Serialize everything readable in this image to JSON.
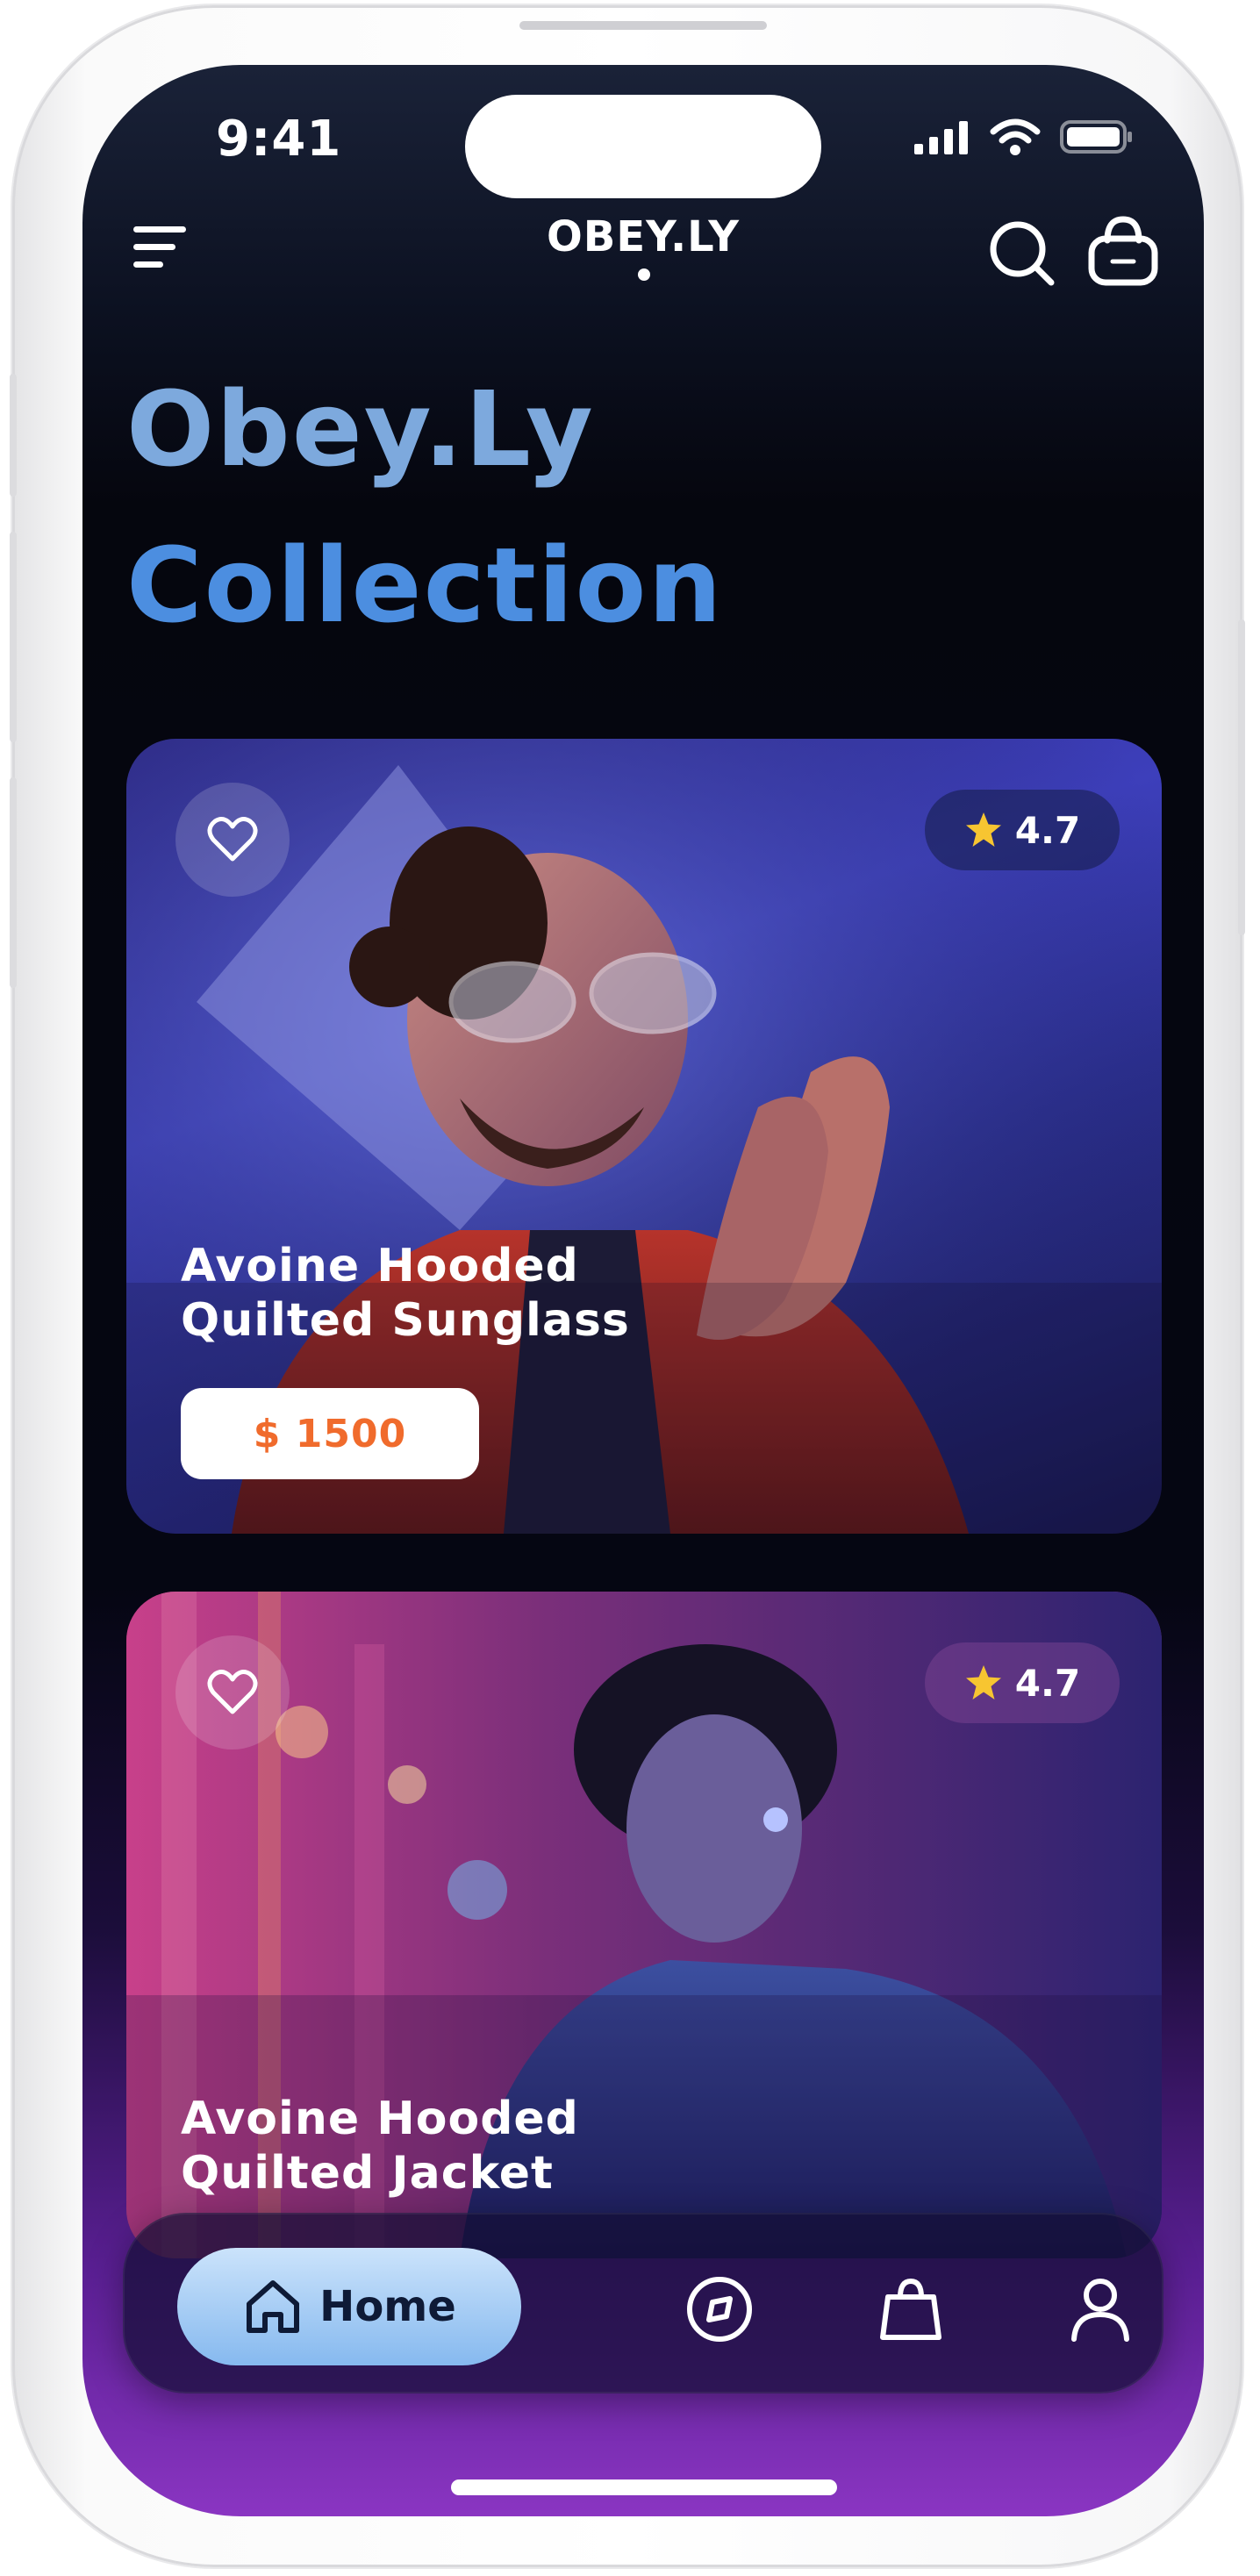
{
  "status_bar": {
    "time": "9:41"
  },
  "header": {
    "logo": "OBEY.LY"
  },
  "hero": {
    "line1": "Obey.Ly",
    "line2": "Collection"
  },
  "products": [
    {
      "name_line1": "Avoine Hooded",
      "name_line2": "Quilted Sunglass",
      "rating": "4.7",
      "price": "$ 1500"
    },
    {
      "name_line1": "Avoine Hooded",
      "name_line2": "Quilted Jacket",
      "rating": "4.7"
    }
  ],
  "bottom_nav": {
    "home_label": "Home",
    "icons": [
      "home-icon",
      "compass-icon",
      "bag-icon",
      "profile-icon"
    ]
  },
  "colors": {
    "accent_blue": "#4c8ee0",
    "title_light": "#7da9dd",
    "price_orange": "#f06b2c",
    "home_pill": "#86b9ef",
    "star": "#f7c531"
  }
}
